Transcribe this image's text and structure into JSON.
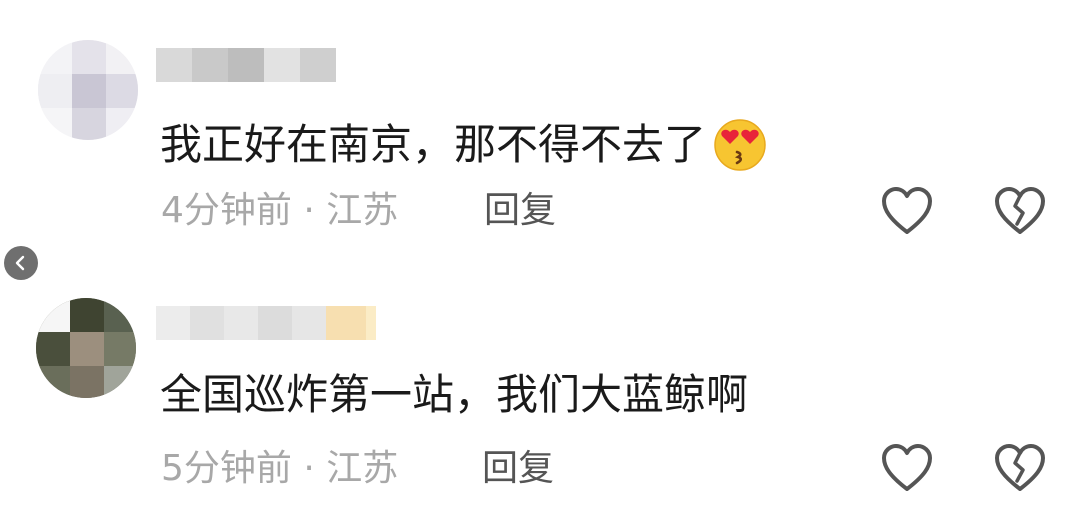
{
  "comments": [
    {
      "text": "我正好在南京，那不得不去了",
      "emoji_icon": "heart-eyes-kiss-emoji-icon",
      "time_location": "4分钟前 · 江苏",
      "reply_label": "回复",
      "like_icon": "heart-outline-icon",
      "dislike_icon": "broken-heart-icon"
    },
    {
      "text": "全国巡炸第一站，我们大蓝鲸啊",
      "time_location": "5分钟前 · 江苏",
      "reply_label": "回复",
      "like_icon": "heart-outline-icon",
      "dislike_icon": "broken-heart-icon"
    }
  ],
  "side_arrow_icon": "chevron-left-icon",
  "colors": {
    "meta_text": "#a8a8a8",
    "body_text": "#1a1a1a",
    "icon_stroke": "#555555"
  }
}
